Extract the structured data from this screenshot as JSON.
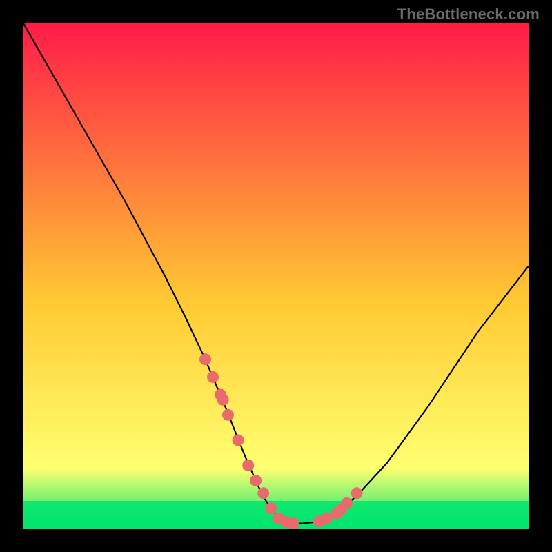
{
  "watermark": "TheBottleneck.com",
  "chart_data": {
    "type": "line",
    "title": "",
    "xlabel": "",
    "ylabel": "",
    "xlim": [
      0,
      100
    ],
    "ylim": [
      0,
      100
    ],
    "background_gradient": {
      "top": "#ff1c48",
      "mid": "#ffc933",
      "lower": "#ffff70",
      "bottom": "#00e56f"
    },
    "series": [
      {
        "name": "curve",
        "x": [
          0,
          4,
          8,
          12,
          16,
          20,
          24,
          28,
          32,
          36,
          40,
          42,
          44,
          46,
          47,
          48,
          49,
          50,
          51,
          52,
          53,
          55,
          58,
          62,
          66,
          72,
          80,
          90,
          100
        ],
        "y": [
          100,
          93,
          86,
          79,
          72,
          65,
          57.5,
          50,
          42,
          33.5,
          24,
          19,
          14,
          9.5,
          7.3,
          5.5,
          4,
          2.8,
          2,
          1.4,
          1.1,
          1,
          1.3,
          3,
          6.5,
          13,
          24,
          39,
          52
        ]
      }
    ],
    "markers": {
      "name": "highlight-dots",
      "color": "#e96a6c",
      "x": [
        36.0,
        37.5,
        39.0,
        39.5,
        40.5,
        42.5,
        44.5,
        46.0,
        47.5,
        49.0,
        50.5,
        52.0,
        53.5,
        58.5,
        60.0,
        62.0,
        62.8,
        64.0,
        66.0
      ],
      "y": [
        33.5,
        30.0,
        26.5,
        25.5,
        22.5,
        17.5,
        12.5,
        9.5,
        7.0,
        4.0,
        2.0,
        1.3,
        1.0,
        1.4,
        2.0,
        3.0,
        3.7,
        5.0,
        7.0
      ]
    }
  }
}
